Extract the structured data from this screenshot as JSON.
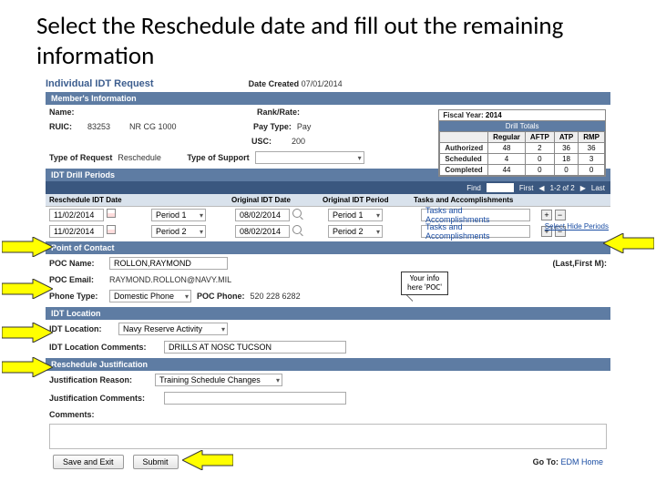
{
  "slide": {
    "title": "Select the Reschedule date and fill out the remaining information"
  },
  "form": {
    "title": "Individual IDT Request",
    "date_created_label": "Date Created",
    "date_created_value": "07/01/2014"
  },
  "drill": {
    "fy_label": "Fiscal Year:",
    "fy_value": "2014",
    "header": "Drill Totals",
    "cols": {
      "c1": "Regular",
      "c2": "AFTP",
      "c3": "ATP",
      "c4": "RMP"
    },
    "rows": {
      "auth": {
        "lbl": "Authorized",
        "v1": "48",
        "v2": "2",
        "v3": "36",
        "v4": "36"
      },
      "sched": {
        "lbl": "Scheduled",
        "v1": "4",
        "v2": "0",
        "v3": "18",
        "v4": "3"
      },
      "comp": {
        "lbl": "Completed",
        "v1": "44",
        "v2": "0",
        "v3": "0",
        "v4": "0"
      }
    }
  },
  "member": {
    "header": "Member's Information",
    "name_label": "Name:",
    "rank_label": "Rank/Rate:",
    "ruic_label": "RUIC:",
    "ruic_value": "83253",
    "ruic2": "NR CG 1000",
    "paytype_label": "Pay Type:",
    "paytype_value": "Pay",
    "usc_label": "USC:",
    "usc_value": "200",
    "type_req_label": "Type of Request",
    "type_req_value": "Reschedule",
    "type_support_label": "Type of Support"
  },
  "periods": {
    "header": "IDT Drill Periods",
    "find_label": "Find",
    "first": "First",
    "paging": "1-2 of 2",
    "last": "Last",
    "cols": {
      "c1": "Reschedule IDT Date",
      "c2": "",
      "c3": "Original IDT Date",
      "c4": "Original IDT Period",
      "c5": "Tasks and Accomplishments",
      "c6": ""
    },
    "row1": {
      "date": "11/02/2014",
      "period": "Period 1",
      "orig_date": "08/02/2014",
      "orig_period": "Period 1",
      "tasks": "Tasks and Accomplishments"
    },
    "row2": {
      "date": "11/02/2014",
      "period": "Period 2",
      "orig_date": "08/02/2014",
      "orig_period": "Period 2",
      "tasks": "Tasks and Accomplishments"
    },
    "select_hide": "Select Hide Periods"
  },
  "poc": {
    "header": "Point of Contact",
    "lastfirst": "(Last,First M):",
    "name_label": "POC Name:",
    "name_value": "ROLLON,RAYMOND",
    "email_label": "POC Email:",
    "email_value": "RAYMOND.ROLLON@NAVY.MIL",
    "phone_type_label": "Phone Type:",
    "phone_type_value": "Domestic Phone",
    "phone_label": "POC Phone:",
    "phone_value": "520 228 6282"
  },
  "loc": {
    "header": "IDT Location",
    "loc_label": "IDT Location:",
    "loc_value": "Navy Reserve Activity",
    "comment_label": "IDT Location Comments:",
    "comment_value": "DRILLS AT NOSC TUCSON"
  },
  "just": {
    "header": "Reschedule Justification",
    "reason_label": "Justification Reason:",
    "reason_value": "Training Schedule Changes",
    "comment_label": "Justification Comments:"
  },
  "comments": {
    "label": "Comments:"
  },
  "footer": {
    "save_exit": "Save and Exit",
    "submit": "Submit",
    "goto_label": "Go To:",
    "goto_link": "EDM Home"
  },
  "callout": {
    "line1": "Your info",
    "line2": "here 'POC'"
  }
}
